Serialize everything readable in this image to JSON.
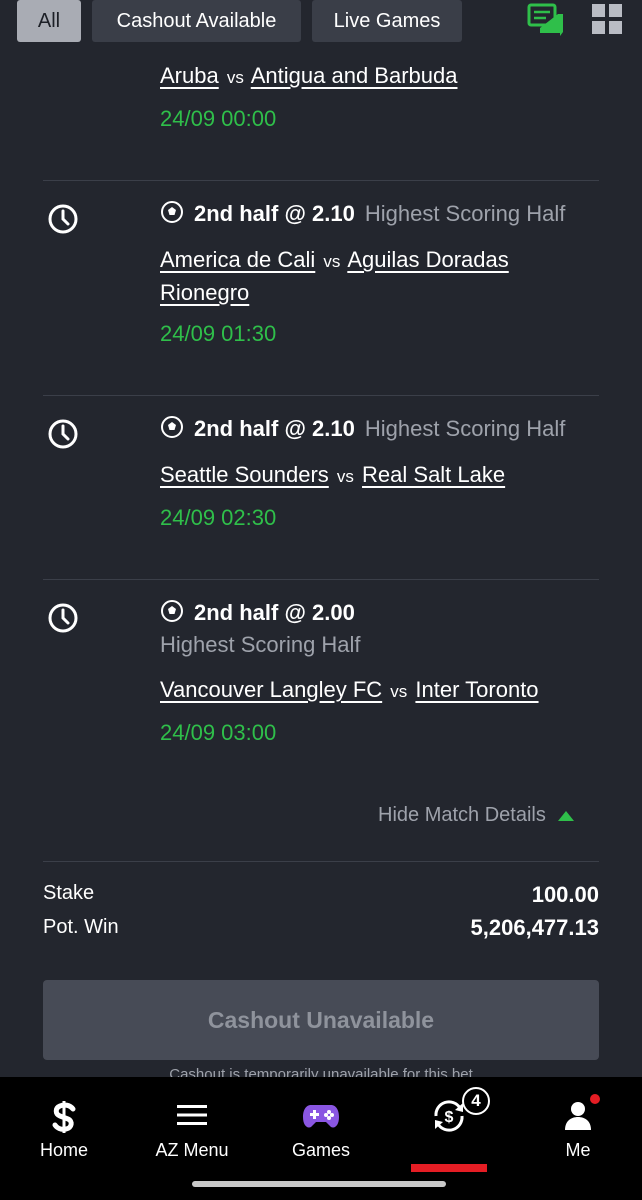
{
  "filters": {
    "all": "All",
    "cashout": "Cashout Available",
    "live": "Live Games"
  },
  "matches": [
    {
      "home": "Aruba",
      "vs": "vs",
      "away": "Antigua and Barbuda",
      "kickoff": "24/09 00:00"
    },
    {
      "pick": "2nd half @ 2.10",
      "market": "Highest Scoring Half",
      "home": "America de Cali",
      "vs": "vs",
      "away": "Aguilas Doradas Rionegro",
      "kickoff": "24/09 01:30"
    },
    {
      "pick": "2nd half @ 2.10",
      "market": "Highest Scoring Half",
      "home": "Seattle Sounders",
      "vs": "vs",
      "away": "Real Salt Lake",
      "kickoff": "24/09 02:30"
    },
    {
      "pick": "2nd half @ 2.00",
      "market": "Highest Scoring Half",
      "home": "Vancouver Langley FC",
      "vs": "vs",
      "away": "Inter Toronto",
      "kickoff": "24/09 03:00"
    }
  ],
  "hide_details": "Hide Match Details",
  "summary": {
    "stake_label": "Stake",
    "stake_value": "100.00",
    "potwin_label": "Pot. Win",
    "potwin_value": "5,206,477.13"
  },
  "cashout": {
    "button": "Cashout Unavailable",
    "note": "Cashout is temporarily unavailable for this bet"
  },
  "nav": {
    "home": "Home",
    "menu": "AZ Menu",
    "games": "Games",
    "bets_badge": "4",
    "me": "Me"
  },
  "colors": {
    "background": "#23262e",
    "accent_green": "#2fbf4a",
    "accent_red": "#e51d24",
    "games_purple": "#8a56e2"
  },
  "icons": [
    "chat-icon",
    "grid-icon",
    "clock-icon",
    "soccer-ball-icon",
    "caret-up-icon",
    "home-logo-icon",
    "menu-icon",
    "gamepad-icon",
    "cashout-bets-icon",
    "user-icon"
  ]
}
